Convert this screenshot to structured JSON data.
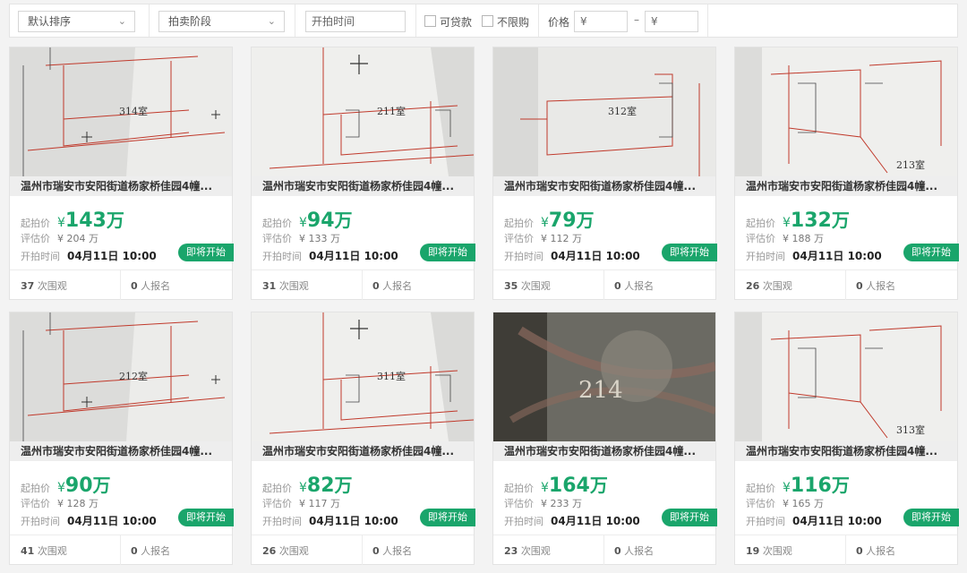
{
  "filters": {
    "sort_label": "默认排序",
    "stage_label": "拍卖阶段",
    "start_time_placeholder": "开拍时间",
    "loan_label": "可贷款",
    "unlimited_label": "不限购",
    "price_label": "价格",
    "price_min_placeholder": "¥",
    "price_max_placeholder": "¥",
    "price_dash": "–"
  },
  "labels": {
    "start_price": "起拍价",
    "eval_price": "评估价",
    "start_time": "开拍时间",
    "views_suffix": "次围观",
    "signups_suffix": "人报名",
    "yen": "¥",
    "wan": "万"
  },
  "listings": [
    {
      "title": "温州市瑞安市安阳街道杨家桥佳园4幢...",
      "start_price": "143",
      "eval_price": "¥ 204 万",
      "start_time": "04月11日 10:00",
      "status": "即将开始",
      "views": "37",
      "signups": "0",
      "thumb_room": "314室"
    },
    {
      "title": "温州市瑞安市安阳街道杨家桥佳园4幢...",
      "start_price": "94",
      "eval_price": "¥ 133 万",
      "start_time": "04月11日 10:00",
      "status": "即将开始",
      "views": "31",
      "signups": "0",
      "thumb_room": "211室"
    },
    {
      "title": "温州市瑞安市安阳街道杨家桥佳园4幢...",
      "start_price": "79",
      "eval_price": "¥ 112 万",
      "start_time": "04月11日 10:00",
      "status": "即将开始",
      "views": "35",
      "signups": "0",
      "thumb_room": "312室"
    },
    {
      "title": "温州市瑞安市安阳街道杨家桥佳园4幢...",
      "start_price": "132",
      "eval_price": "¥ 188 万",
      "start_time": "04月11日 10:00",
      "status": "即将开始",
      "views": "26",
      "signups": "0",
      "thumb_room": "213室"
    },
    {
      "title": "温州市瑞安市安阳街道杨家桥佳园4幢...",
      "start_price": "90",
      "eval_price": "¥ 128 万",
      "start_time": "04月11日 10:00",
      "status": "即将开始",
      "views": "41",
      "signups": "0",
      "thumb_room": "212室"
    },
    {
      "title": "温州市瑞安市安阳街道杨家桥佳园4幢...",
      "start_price": "82",
      "eval_price": "¥ 117 万",
      "start_time": "04月11日 10:00",
      "status": "即将开始",
      "views": "26",
      "signups": "0",
      "thumb_room": "311室"
    },
    {
      "title": "温州市瑞安市安阳街道杨家桥佳园4幢...",
      "start_price": "164",
      "eval_price": "¥ 233 万",
      "start_time": "04月11日 10:00",
      "status": "即将开始",
      "views": "23",
      "signups": "0",
      "thumb_room": "214"
    },
    {
      "title": "温州市瑞安市安阳街道杨家桥佳园4幢...",
      "start_price": "116",
      "eval_price": "¥ 165 万",
      "start_time": "04月11日 10:00",
      "status": "即将开始",
      "views": "19",
      "signups": "0",
      "thumb_room": "313室"
    }
  ]
}
